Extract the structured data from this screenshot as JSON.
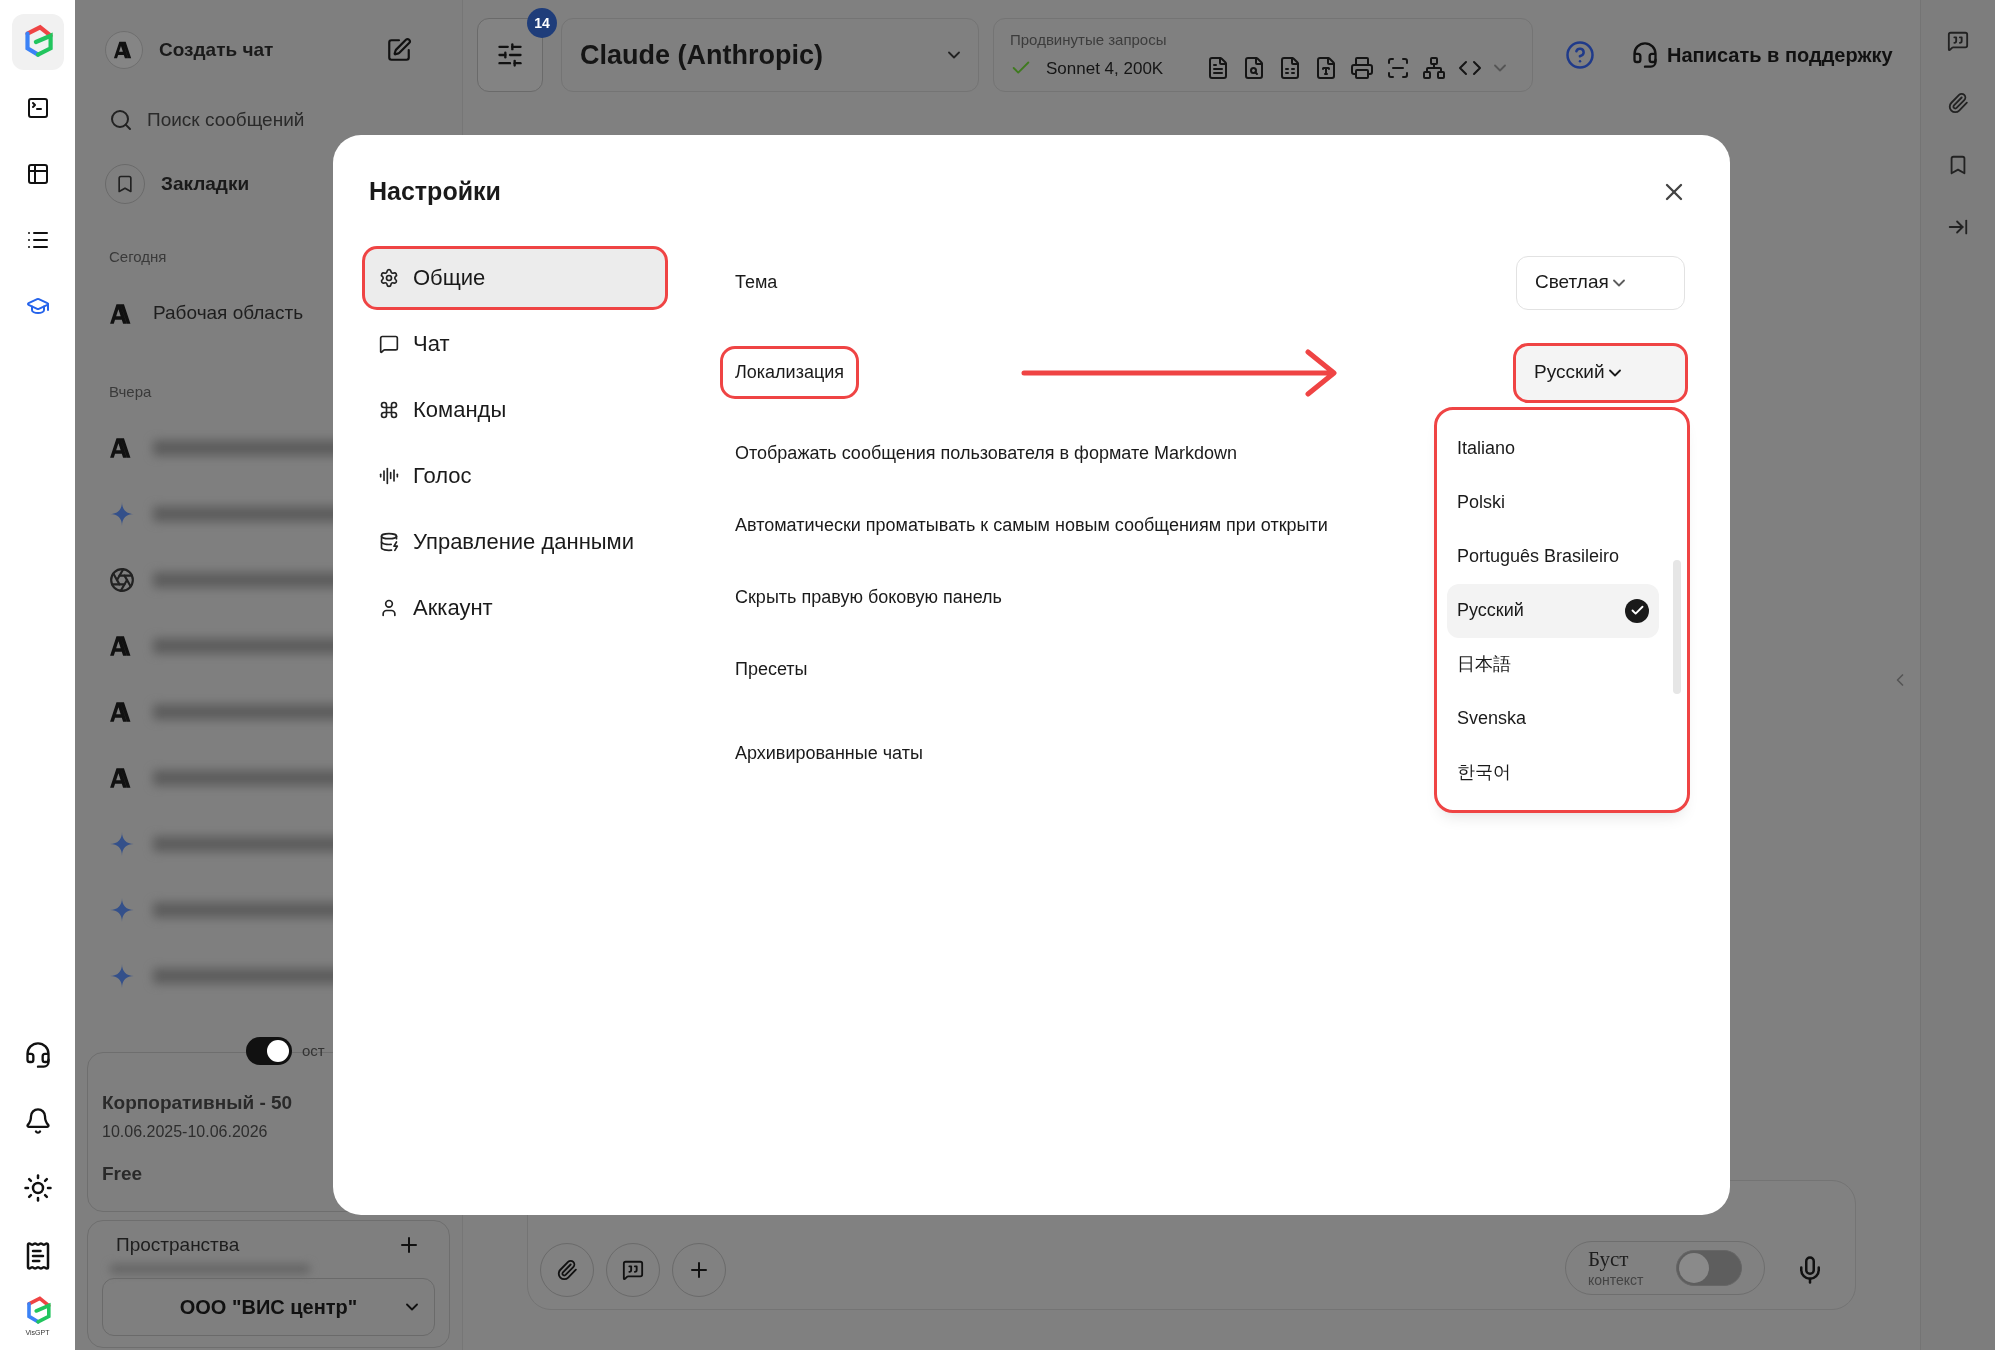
{
  "icon_rail": {
    "items": [
      {
        "kind": "terminal",
        "selected": false
      },
      {
        "kind": "table",
        "selected": false
      },
      {
        "kind": "list",
        "selected": false
      },
      {
        "kind": "learn",
        "selected": true
      }
    ],
    "bottom_items": [
      {
        "kind": "support"
      },
      {
        "kind": "bell"
      },
      {
        "kind": "theme"
      },
      {
        "kind": "notes"
      }
    ],
    "brand": "VisGPT"
  },
  "sidebar": {
    "new_chat": "Создать чат",
    "search_placeholder": "Поиск сообщений",
    "bookmarks": "Закладки",
    "groups": [
      {
        "label": "Сегодня",
        "chats": [
          {
            "kind": "anthropic",
            "title": "Рабочая область"
          }
        ]
      },
      {
        "label": "Вчера",
        "chats": [
          {
            "kind": "anthropic"
          },
          {
            "kind": "gemini"
          },
          {
            "kind": "openai"
          },
          {
            "kind": "anthropic"
          },
          {
            "kind": "anthropic"
          },
          {
            "kind": "anthropic"
          },
          {
            "kind": "gemini"
          },
          {
            "kind": "gemini"
          },
          {
            "kind": "gemini"
          }
        ]
      }
    ],
    "toggle": {
      "on": true,
      "label": "ост"
    },
    "plan": {
      "name": "Корпоративный - 50",
      "period": "10.06.2025-10.06.2026",
      "tier": "Free"
    },
    "spaces": {
      "title": "Пространства",
      "selected": "ООО \"ВИС центр\""
    }
  },
  "topbar": {
    "filter_badge": "14",
    "model": "Claude (Anthropic)",
    "advanced": {
      "label": "Продвинутые запросы",
      "model": "Sonnet 4, 200K"
    },
    "support": "Написать в поддержку"
  },
  "composer": {
    "boost": {
      "label": "Буст",
      "sublabel": "контекст",
      "on": false
    }
  },
  "settings_dialog": {
    "title": "Настройки",
    "nav": [
      {
        "kind": "general",
        "label": "Общие",
        "selected": true,
        "highlighted": true
      },
      {
        "kind": "chat",
        "label": "Чат",
        "selected": false,
        "highlighted": false
      },
      {
        "kind": "commands",
        "label": "Команды",
        "selected": false,
        "highlighted": false
      },
      {
        "kind": "voice",
        "label": "Голос",
        "selected": false,
        "highlighted": false
      },
      {
        "kind": "data",
        "label": "Управление данными",
        "selected": false,
        "highlighted": false
      },
      {
        "kind": "account",
        "label": "Аккаунт",
        "selected": false,
        "highlighted": false
      }
    ],
    "settings": [
      {
        "kind": "select",
        "label": "Тема",
        "value": "Светлая",
        "label_highlighted": false,
        "value_highlighted": false,
        "arrow": false
      },
      {
        "kind": "select",
        "label": "Локализация",
        "value": "Русский",
        "label_highlighted": true,
        "value_highlighted": true,
        "arrow": true,
        "open": true
      },
      {
        "kind": "plain",
        "label": "Отображать сообщения пользователя в формате Markdown"
      },
      {
        "kind": "plain",
        "label": "Автоматически проматывать к самым новым сообщениям при открыти"
      },
      {
        "kind": "plain",
        "label": "Скрыть правую боковую панель"
      },
      {
        "kind": "plain",
        "label": "Пресеты"
      },
      {
        "kind": "plain",
        "label": "Архивированные чаты"
      }
    ],
    "language_options": {
      "highlighted": true,
      "items": [
        {
          "label": "Italiano",
          "selected": false
        },
        {
          "label": "Polski",
          "selected": false
        },
        {
          "label": "Português Brasileiro",
          "selected": false
        },
        {
          "label": "Русский",
          "selected": true
        },
        {
          "label": "日本語",
          "selected": false
        },
        {
          "label": "Svenska",
          "selected": false
        },
        {
          "label": "한국어",
          "selected": false
        }
      ]
    }
  }
}
